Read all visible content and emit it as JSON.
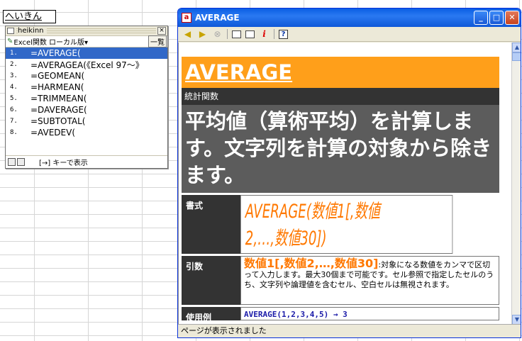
{
  "ime": {
    "input_text": "へいきん",
    "title": "heikinn",
    "dict_label": "Excel関数 ローカル版▾",
    "list_button": "一覧",
    "close": "×",
    "candidates": [
      {
        "no": "1.",
        "text": "=AVERAGE("
      },
      {
        "no": "2.",
        "text": "=AVERAGEA(《Excel 97〜》"
      },
      {
        "no": "3.",
        "text": "=GEOMEAN("
      },
      {
        "no": "4.",
        "text": "=HARMEAN("
      },
      {
        "no": "5.",
        "text": "=TRIMMEAN("
      },
      {
        "no": "6.",
        "text": "=DAVERAGE("
      },
      {
        "no": "7.",
        "text": "=SUBTOTAL("
      },
      {
        "no": "8.",
        "text": "=AVEDEV("
      }
    ],
    "footer_hint": "[→] キーで表示"
  },
  "window": {
    "title": "AVERAGE",
    "min": "_",
    "max": "□",
    "close": "✕"
  },
  "help": {
    "func_name": "AVERAGE",
    "category": "統計関数",
    "summary": "平均値（算術平均）を計算します。文字列を計算の対象から除きます。",
    "syntax_label": "書式",
    "syntax": "AVERAGE(数値1[,数値2,…,数値30])",
    "args_label": "引数",
    "arg_name": "数値1[,数値2,…,数値30]",
    "arg_desc": ":対象になる数値をカンマで区切って入力します。最大30個まで可能です。セル参照で指定したセルのうち、文字列や論理値を含むセル、空白セルは無視されます。",
    "example_label": "使用例",
    "example": "AVERAGE(1,2,3,4,5)  →  3"
  },
  "status": "ページが表示されました"
}
